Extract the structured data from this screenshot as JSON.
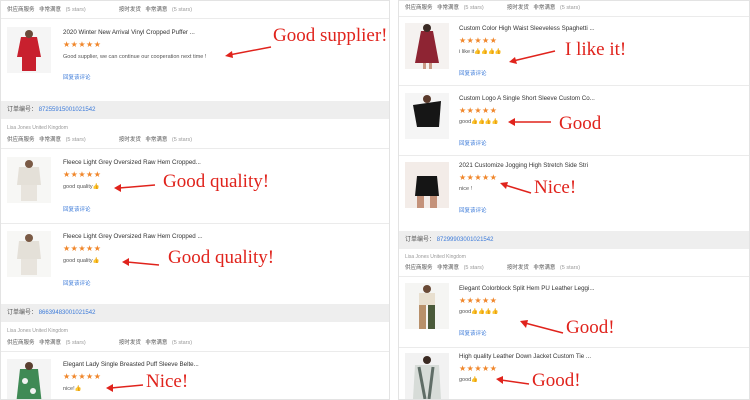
{
  "common": {
    "supplier_label": "供应商服务",
    "very_satisfied": "非常满意",
    "on_time_label": "按时发货",
    "five_stars": "(5 stars)",
    "reply_label": "回复该评论",
    "order_label": "订单编号",
    "buyer": "Lisa Jones United Kingdom",
    "star_glyphs": "★★★★★"
  },
  "left": {
    "top_row": {
      "supplier": "供应商服务",
      "rating": "非常满意",
      "stars": "(5 stars)",
      "ontime": "按时发货",
      "rating2": "非常满意",
      "stars2": "(5 stars)"
    },
    "items_a": [
      {
        "title": "2020 Winter New Arrival Vinyl Cropped Puffer ...",
        "comment": "Good supplier, we can continue our cooperation next time !",
        "annotation": "Good supplier!"
      }
    ],
    "order_b": "87255915001021542",
    "items_b": [
      {
        "title": "Fleece Light Grey Oversized Raw Hem Cropped...",
        "comment": "good quality👍",
        "annotation": "Good quality!"
      },
      {
        "title": "Fleece Light Grey Oversized Raw Hem Cropped ...",
        "comment": "good quality👍",
        "annotation": "Good quality!"
      }
    ],
    "order_c": "86639483001021542",
    "items_c": [
      {
        "title": "Elegant Lady Single Breasted Puff Sleeve Belte...",
        "comment": "nice!👍",
        "annotation": "Nice!"
      }
    ]
  },
  "right": {
    "top_row": {
      "supplier": "供应商服务",
      "rating": "非常满意",
      "stars": "(5 stars)",
      "ontime": "按时发货",
      "rating2": "非常满意",
      "stars2": "(5 stars)"
    },
    "items_a": [
      {
        "title": "Custom Color High Waist Sleeveless Spaghetti ...",
        "comment": "i like it👍👍👍👍",
        "annotation": "I like it!"
      },
      {
        "title": "Custom Logo A Single Short Sleeve Custom Co...",
        "comment": "good👍👍👍👍",
        "annotation": "Good"
      },
      {
        "title": "2021 Customize Jogging High Stretch Side Stri",
        "comment": "nice !",
        "annotation": "Nice!"
      }
    ],
    "order_b": "87299903001021542",
    "items_b": [
      {
        "title": "Elegant Colorblock Split Hem PU Leather Leggi...",
        "comment": "good👍👍👍👍",
        "annotation": "Good!"
      },
      {
        "title": "High quality Leather Down Jacket Custom Tie ...",
        "comment": "good👍",
        "annotation": "Good!"
      }
    ]
  },
  "colors": {
    "annotation": "#e0231c",
    "stars": "#f0862a",
    "link": "#3b7ad9",
    "order_bar": "#eeeeee"
  }
}
